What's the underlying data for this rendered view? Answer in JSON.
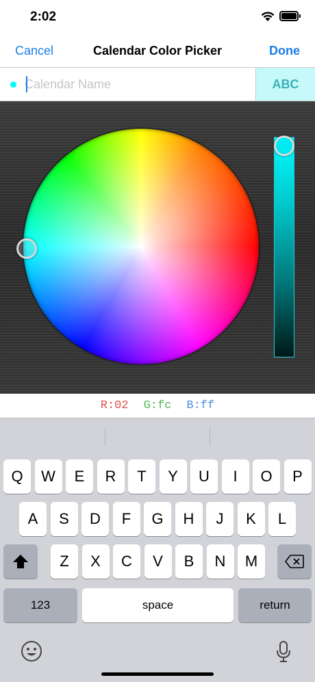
{
  "status": {
    "time": "2:02"
  },
  "nav": {
    "cancel": "Cancel",
    "title": "Calendar Color Picker",
    "done": "Done"
  },
  "name_field": {
    "placeholder": "Calendar Name",
    "value": "",
    "style_button": "ABC"
  },
  "colors": {
    "selected": "#02fcff",
    "accent": "#1a7fe8"
  },
  "rgb": {
    "r": "R:02",
    "g": "G:fc",
    "b": "B:ff"
  },
  "brightness_level": 1.0,
  "keyboard": {
    "row1": [
      "Q",
      "W",
      "E",
      "R",
      "T",
      "Y",
      "U",
      "I",
      "O",
      "P"
    ],
    "row2": [
      "A",
      "S",
      "D",
      "F",
      "G",
      "H",
      "J",
      "K",
      "L"
    ],
    "row3": [
      "Z",
      "X",
      "C",
      "V",
      "B",
      "N",
      "M"
    ],
    "numbers": "123",
    "space": "space",
    "return": "return",
    "icons": [
      "shift-icon",
      "delete-icon",
      "emoji-icon",
      "microphone-icon"
    ]
  }
}
